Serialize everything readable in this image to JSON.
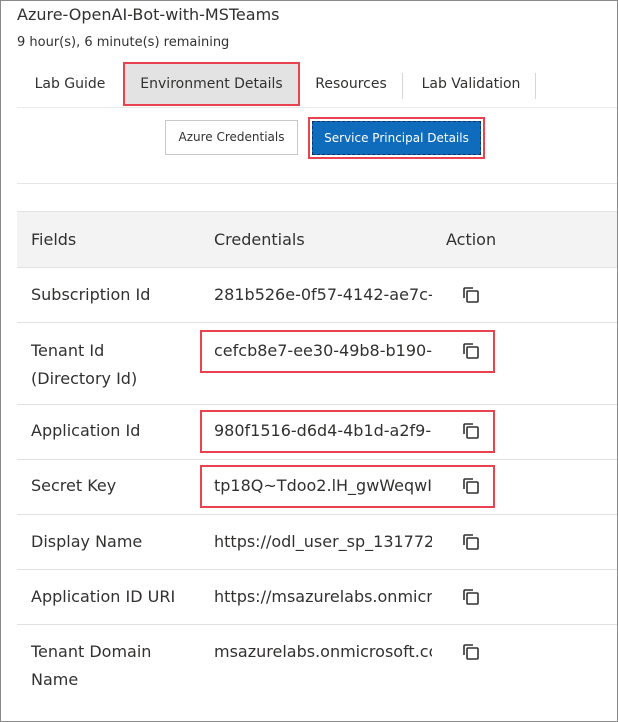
{
  "header": {
    "title": "Azure-OpenAI-Bot-with-MSTeams",
    "time_remaining": "9 hour(s), 6 minute(s) remaining"
  },
  "tabs": [
    {
      "label": "Lab Guide",
      "active": false
    },
    {
      "label": "Environment Details",
      "active": true
    },
    {
      "label": "Resources",
      "active": false
    },
    {
      "label": "Lab Validation",
      "active": false
    }
  ],
  "subtabs": {
    "azure_credentials": "Azure Credentials",
    "service_principal": "Service Principal Details"
  },
  "table": {
    "columns": [
      "Fields",
      "Credentials",
      "Action"
    ],
    "rows": [
      {
        "field": "Subscription Id",
        "value": "281b526e-0f57-4142-ae7c-",
        "highlighted": false
      },
      {
        "field": "Tenant Id\n(Directory Id)",
        "value": "cefcb8e7-ee30-49b8-b190-",
        "highlighted": true
      },
      {
        "field": "Application Id",
        "value": "980f1516-d6d4-4b1d-a2f9-",
        "highlighted": true
      },
      {
        "field": "Secret Key",
        "value": "tp18Q~Tdoo2.lH_gwWeqwI",
        "highlighted": true
      },
      {
        "field": "Display Name",
        "value": "https://odl_user_sp_131772",
        "highlighted": false
      },
      {
        "field": "Application ID URI",
        "value": "https://msazurelabs.onmicro",
        "highlighted": false
      },
      {
        "field": "Tenant Domain\nName",
        "value": "msazurelabs.onmicrosoft.co",
        "highlighted": false
      }
    ],
    "action_icon": "copy-icon"
  },
  "colors": {
    "accent": "#0f6cbd",
    "highlight": "#e8434f",
    "header_bg": "#f3f3f3"
  }
}
